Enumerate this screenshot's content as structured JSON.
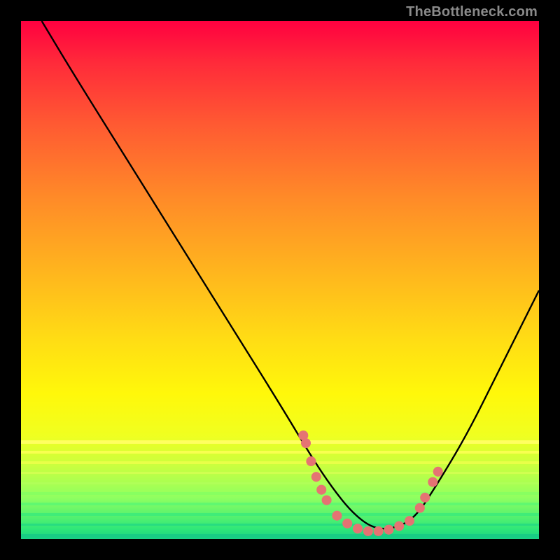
{
  "watermark": "TheBottleneck.com",
  "chart_data": {
    "type": "line",
    "title": "",
    "xlabel": "",
    "ylabel": "",
    "xlim": [
      0,
      100
    ],
    "ylim": [
      0,
      100
    ],
    "grid": false,
    "series": [
      {
        "name": "curve",
        "x": [
          4,
          10,
          20,
          30,
          40,
          50,
          56,
          60,
          64,
          68,
          72,
          76,
          80,
          86,
          92,
          100
        ],
        "y": [
          100,
          90,
          74,
          58,
          42,
          26,
          16,
          10,
          5,
          2,
          2,
          4,
          10,
          20,
          32,
          48
        ]
      }
    ],
    "points": {
      "name": "markers",
      "x": [
        54.5,
        55,
        56,
        57,
        58,
        59,
        61,
        63,
        65,
        67,
        69,
        71,
        73,
        75,
        77,
        78,
        79.5,
        80.5
      ],
      "y": [
        20,
        18.5,
        15,
        12,
        9.5,
        7.5,
        4.5,
        3,
        2,
        1.5,
        1.5,
        1.8,
        2.5,
        3.5,
        6,
        8,
        11,
        13
      ]
    },
    "point_color": "#e57373",
    "curve_color": "#000000",
    "gradient_stops": [
      {
        "pos": 0,
        "color": "#ff0040"
      },
      {
        "pos": 8,
        "color": "#ff2a3a"
      },
      {
        "pos": 20,
        "color": "#ff5a32"
      },
      {
        "pos": 34,
        "color": "#ff8a28"
      },
      {
        "pos": 48,
        "color": "#ffb41e"
      },
      {
        "pos": 62,
        "color": "#ffde14"
      },
      {
        "pos": 72,
        "color": "#fff80a"
      },
      {
        "pos": 80,
        "color": "#f0ff20"
      },
      {
        "pos": 86,
        "color": "#c8ff40"
      },
      {
        "pos": 92,
        "color": "#90ff60"
      },
      {
        "pos": 98,
        "color": "#30e878"
      },
      {
        "pos": 100,
        "color": "#18d084"
      }
    ],
    "bottom_stripes": [
      {
        "y": 81,
        "h": 0.6,
        "color": "#ffff60"
      },
      {
        "y": 83,
        "h": 0.5,
        "color": "#f8ff50"
      },
      {
        "y": 85,
        "h": 0.5,
        "color": "#e8ff48"
      },
      {
        "y": 87,
        "h": 0.5,
        "color": "#d0ff50"
      },
      {
        "y": 89,
        "h": 0.5,
        "color": "#b0ff58"
      },
      {
        "y": 91,
        "h": 0.5,
        "color": "#88ff60"
      },
      {
        "y": 93,
        "h": 0.5,
        "color": "#60f870"
      },
      {
        "y": 95,
        "h": 0.5,
        "color": "#40ec78"
      },
      {
        "y": 97,
        "h": 0.5,
        "color": "#28dc80"
      },
      {
        "y": 99,
        "h": 0.7,
        "color": "#18cc84"
      }
    ]
  }
}
